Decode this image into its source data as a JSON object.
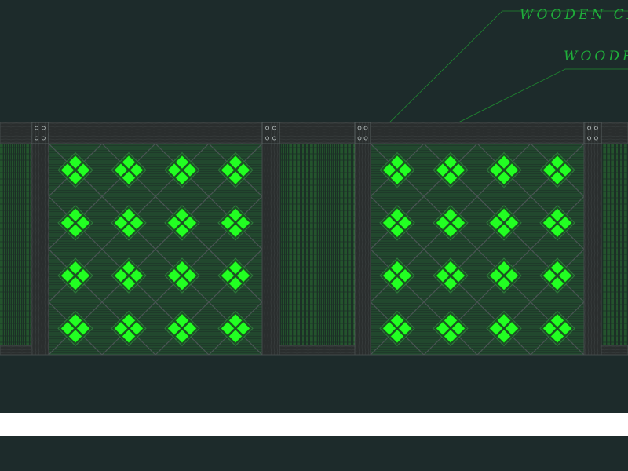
{
  "labels": {
    "cross_label": "WOODEN CROSS",
    "wooden_label": "WOODEN"
  },
  "colors": {
    "background": "#1d2b2b",
    "frame": "#2a2e2e",
    "grain": "#3b4141",
    "bolt": "#b8c0c0",
    "lattice_line": "#2e7a3a",
    "lattice_fill": "#1f4a2a",
    "diamond": "#22ff22",
    "leader": "#1f8a30",
    "slat": "#2b7a34",
    "band": "#ffffff"
  },
  "icons": {
    "post": "wooden-post",
    "panel": "diamond-lattice-panel",
    "slats": "vertical-slat-infill",
    "bolt": "bolt-icon"
  }
}
